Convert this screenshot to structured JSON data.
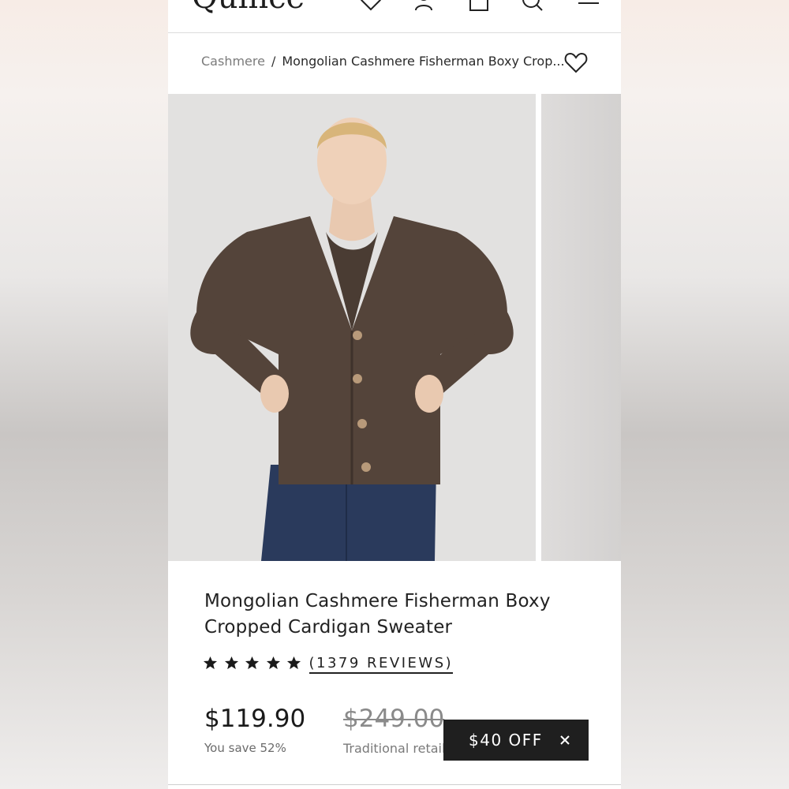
{
  "header": {
    "logo": "Quince",
    "icons": [
      "heart-icon",
      "account-icon",
      "bag-icon",
      "search-icon",
      "menu-icon"
    ]
  },
  "breadcrumb": {
    "parent": "Cashmere",
    "separator": "/",
    "current": "Mongolian Cashmere Fisherman Boxy Crop..."
  },
  "product": {
    "title": "Mongolian Cashmere Fisherman Boxy Cropped Cardigan Sweater",
    "rating": 5,
    "reviews_label": "(1379 REVIEWS)",
    "price": "$119.90",
    "savings": "You save 52%",
    "retail_price": "$249.00",
    "retail_label": "Traditional retail"
  },
  "promo": {
    "label": "$40 OFF"
  },
  "colors": {
    "sweater": "#54443a",
    "denim": "#2a3a5c",
    "promo_bg": "#1f1f1f"
  }
}
